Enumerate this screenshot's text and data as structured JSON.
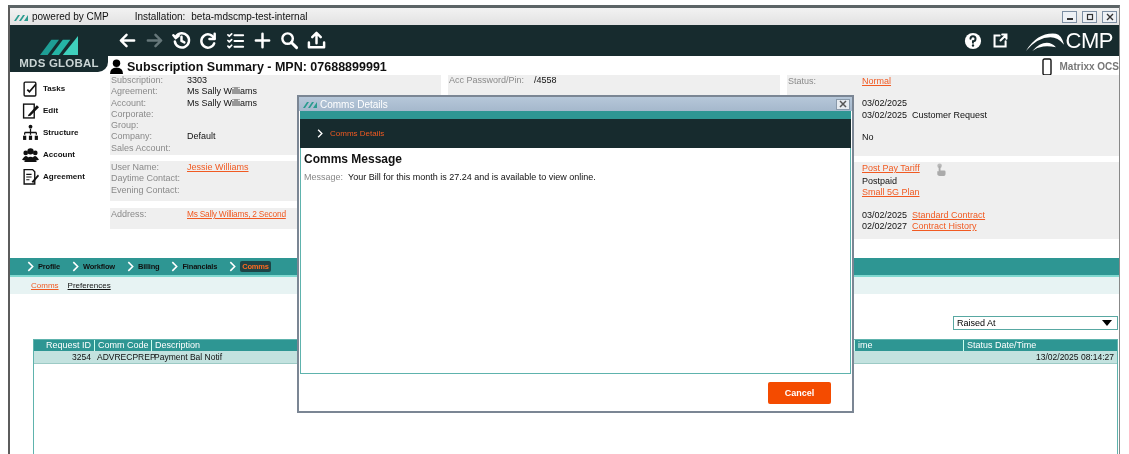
{
  "window": {
    "app_label": "powered by CMP",
    "installation_label": "Installation:",
    "installation": "beta-mdscmp-test-internal"
  },
  "toolbar": {
    "brand": "MDS GLOBAL",
    "product": "CMP",
    "tools": [
      {
        "kind": "back",
        "disabled": false
      },
      {
        "kind": "forward",
        "disabled": true
      },
      {
        "kind": "history",
        "disabled": false
      },
      {
        "kind": "redo",
        "disabled": false
      },
      {
        "kind": "checklist",
        "disabled": false
      },
      {
        "kind": "add",
        "disabled": false
      },
      {
        "kind": "search",
        "disabled": false
      },
      {
        "kind": "upload",
        "disabled": false
      }
    ],
    "actions": [
      {
        "kind": "help"
      },
      {
        "kind": "external"
      }
    ]
  },
  "sidebar": [
    {
      "kind": "tasks",
      "label": "Tasks"
    },
    {
      "kind": "edit",
      "label": "Edit"
    },
    {
      "kind": "structure",
      "label": "Structure"
    },
    {
      "kind": "account",
      "label": "Account"
    },
    {
      "kind": "agreement",
      "label": "Agreement"
    }
  ],
  "summary": {
    "title": "Subscription Summary - MPN: 07688899991",
    "system": "Matrixx OCS",
    "subscription_fields": [
      {
        "label": "Subscription:",
        "value": "3303"
      },
      {
        "label": "Agreement:",
        "value": "Ms Sally Williams"
      },
      {
        "label": "Account:",
        "value": "Ms Sally Williams"
      },
      {
        "label": "Corporate:"
      },
      {
        "label": "Group:"
      },
      {
        "label": "Company:",
        "value": "Default"
      },
      {
        "label": "Sales Account:"
      }
    ],
    "contact_fields": [
      {
        "label": "User Name:",
        "value": "Jessie Williams",
        "link": true
      },
      {
        "label": "Daytime Contact:"
      },
      {
        "label": "Evening Contact:"
      }
    ],
    "address": {
      "label": "Address:",
      "value": "Ms Sally Williams, 2 Second",
      "link": true
    },
    "credentials": [
      {
        "label": "Acc Password/Pin:",
        "value": "/4558"
      }
    ],
    "status_groups": [
      [
        {
          "label": "Status:",
          "value": "Normal",
          "link": true
        }
      ],
      [
        {
          "value": "03/02/2025",
          "link": false
        },
        {
          "date": "03/02/2025",
          "value": "Customer Request",
          "link": false
        }
      ],
      [
        {
          "value": "No",
          "link": false
        }
      ]
    ],
    "plan_groups": [
      [
        {
          "value": "Post Pay Tariff",
          "link": true
        },
        {
          "value": "Postpaid",
          "link": false
        },
        {
          "value": "Small 5G Plan",
          "link": true
        }
      ],
      [
        {
          "date": "03/02/2025",
          "value": "Standard Contract",
          "link": true
        },
        {
          "date": "02/02/2027",
          "value": "Contract History",
          "link": true
        }
      ]
    ]
  },
  "nav_tabs": [
    {
      "label": "Profile",
      "selected": false
    },
    {
      "label": "Workflow",
      "selected": false
    },
    {
      "label": "Billing",
      "selected": false
    },
    {
      "label": "Financials",
      "selected": false
    },
    {
      "label": "Comms",
      "selected": true
    }
  ],
  "sub_tabs": [
    {
      "label": "Comms",
      "selected": true
    },
    {
      "label": "Preferences",
      "selected": false
    }
  ],
  "sort": {
    "value": "Raised At"
  },
  "table": {
    "columns": [
      "Request ID",
      "Comm Code",
      "Description",
      "ime",
      "Status Date/Time"
    ],
    "rows": [
      {
        "request_id": "3254",
        "comm_code": "ADVRECPREP",
        "description": "Payment Bal Notif",
        "status_datetime": "13/02/2025  08:14:27"
      }
    ]
  },
  "modal": {
    "title": "Comms Details",
    "breadcrumb": "Comms Details",
    "heading": "Comms Message",
    "message_label": "Message:",
    "message": "Your Bill for this month is 27.24 and is available to view online.",
    "cancel": "Cancel"
  }
}
